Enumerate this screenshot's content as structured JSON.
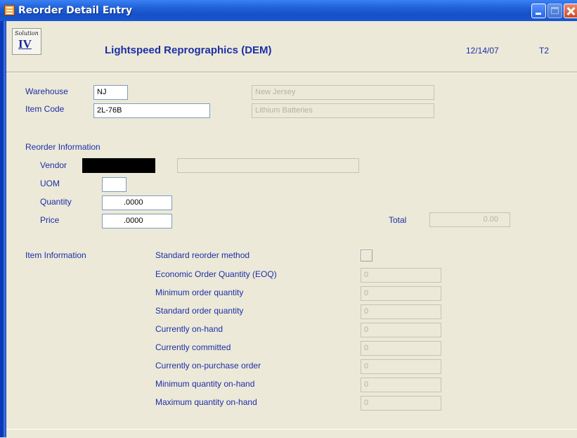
{
  "window": {
    "title": "Reorder Detail Entry"
  },
  "header": {
    "logo_script": "Solution",
    "logo_numeral": "IV",
    "company": "Lightspeed Reprographics (DEM)",
    "date": "12/14/07",
    "terminal": "T2"
  },
  "item": {
    "warehouse_label": "Warehouse",
    "warehouse_value": "NJ",
    "warehouse_desc": "New Jersey",
    "item_code_label": "Item Code",
    "item_code_value": "2L-76B",
    "item_desc": "Lithium Batteries"
  },
  "reorder": {
    "section_label": "Reorder Information",
    "vendor_label": "Vendor",
    "vendor_value": "",
    "vendor_desc": "",
    "uom_label": "UOM",
    "uom_value": "",
    "quantity_label": "Quantity",
    "quantity_value": ".0000",
    "price_label": "Price",
    "price_value": ".0000",
    "total_label": "Total",
    "total_value": "0.00"
  },
  "item_info": {
    "section_label": "Item Information",
    "standard_reorder_method_label": "Standard reorder method",
    "standard_reorder_method_checked": false,
    "rows": [
      {
        "label": "Economic Order Quantity (EOQ)",
        "value": "0"
      },
      {
        "label": "Minimum order quantity",
        "value": "0"
      },
      {
        "label": "Standard order quantity",
        "value": "0"
      },
      {
        "label": "Currently on-hand",
        "value": "0"
      },
      {
        "label": "Currently committed",
        "value": "0"
      },
      {
        "label": "Currently on-purchase order",
        "value": "0"
      },
      {
        "label": "Minimum quantity on-hand",
        "value": "0"
      },
      {
        "label": "Maximum quantity on-hand",
        "value": "0"
      }
    ]
  },
  "colors": {
    "title_bar": "#1f5fd6",
    "label_text": "#1c2fa8",
    "window_background": "#ece9d8"
  },
  "icons": {
    "app": "grid-form-icon",
    "minimize": "minimize-icon",
    "maximize": "maximize-icon",
    "close": "close-icon"
  }
}
